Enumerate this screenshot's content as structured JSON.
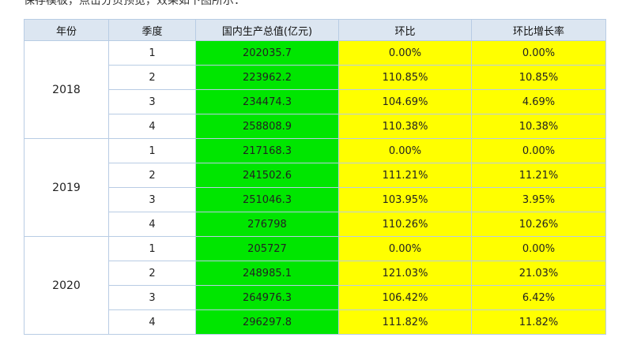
{
  "intro_text": "保存模板，点击分页预览，效果如下图所示：",
  "footer_text": "",
  "table": {
    "headers": [
      "年份",
      "季度",
      "国内生产总值(亿元)",
      "环比",
      "环比增长率"
    ],
    "groups": [
      {
        "year": "2018",
        "rows": [
          {
            "quarter": "1",
            "gdp": "202035.7",
            "ratio": "0.00%",
            "growth": "0.00%"
          },
          {
            "quarter": "2",
            "gdp": "223962.2",
            "ratio": "110.85%",
            "growth": "10.85%"
          },
          {
            "quarter": "3",
            "gdp": "234474.3",
            "ratio": "104.69%",
            "growth": "4.69%"
          },
          {
            "quarter": "4",
            "gdp": "258808.9",
            "ratio": "110.38%",
            "growth": "10.38%"
          }
        ]
      },
      {
        "year": "2019",
        "rows": [
          {
            "quarter": "1",
            "gdp": "217168.3",
            "ratio": "0.00%",
            "growth": "0.00%"
          },
          {
            "quarter": "2",
            "gdp": "241502.6",
            "ratio": "111.21%",
            "growth": "11.21%"
          },
          {
            "quarter": "3",
            "gdp": "251046.3",
            "ratio": "103.95%",
            "growth": "3.95%"
          },
          {
            "quarter": "4",
            "gdp": "276798",
            "ratio": "110.26%",
            "growth": "10.26%"
          }
        ]
      },
      {
        "year": "2020",
        "rows": [
          {
            "quarter": "1",
            "gdp": "205727",
            "ratio": "0.00%",
            "growth": "0.00%"
          },
          {
            "quarter": "2",
            "gdp": "248985.1",
            "ratio": "121.03%",
            "growth": "21.03%"
          },
          {
            "quarter": "3",
            "gdp": "264976.3",
            "ratio": "106.42%",
            "growth": "6.42%"
          },
          {
            "quarter": "4",
            "gdp": "296297.8",
            "ratio": "111.82%",
            "growth": "11.82%"
          }
        ]
      }
    ]
  },
  "colors": {
    "header_bg": "#dce6f1",
    "border": "#b8cce4",
    "gdp_fill": "#00e600",
    "ratio_fill": "#ffff00"
  }
}
